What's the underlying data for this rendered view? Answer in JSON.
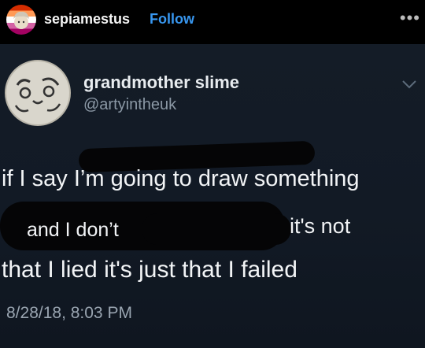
{
  "header": {
    "username": "sepiamestus",
    "follow_label": "Follow",
    "more_label": "•••"
  },
  "tweet": {
    "display_name": "grandmother slime",
    "handle": "@artyintheuk",
    "text_line1": "if I say I’m going to draw something",
    "text_line2a": "and I don’t",
    "text_line2b": "it's not",
    "text_line3": "that I lied it's just that I failed",
    "timestamp": "8/28/18, 8:03 PM"
  },
  "colors": {
    "follow": "#3897f0",
    "tweet_background": "#141c27",
    "scribble": "#050506"
  },
  "icons": [
    "avatar-pride-flag",
    "more-icon",
    "tweet-avatar-drawing",
    "chevron-down-icon"
  ]
}
